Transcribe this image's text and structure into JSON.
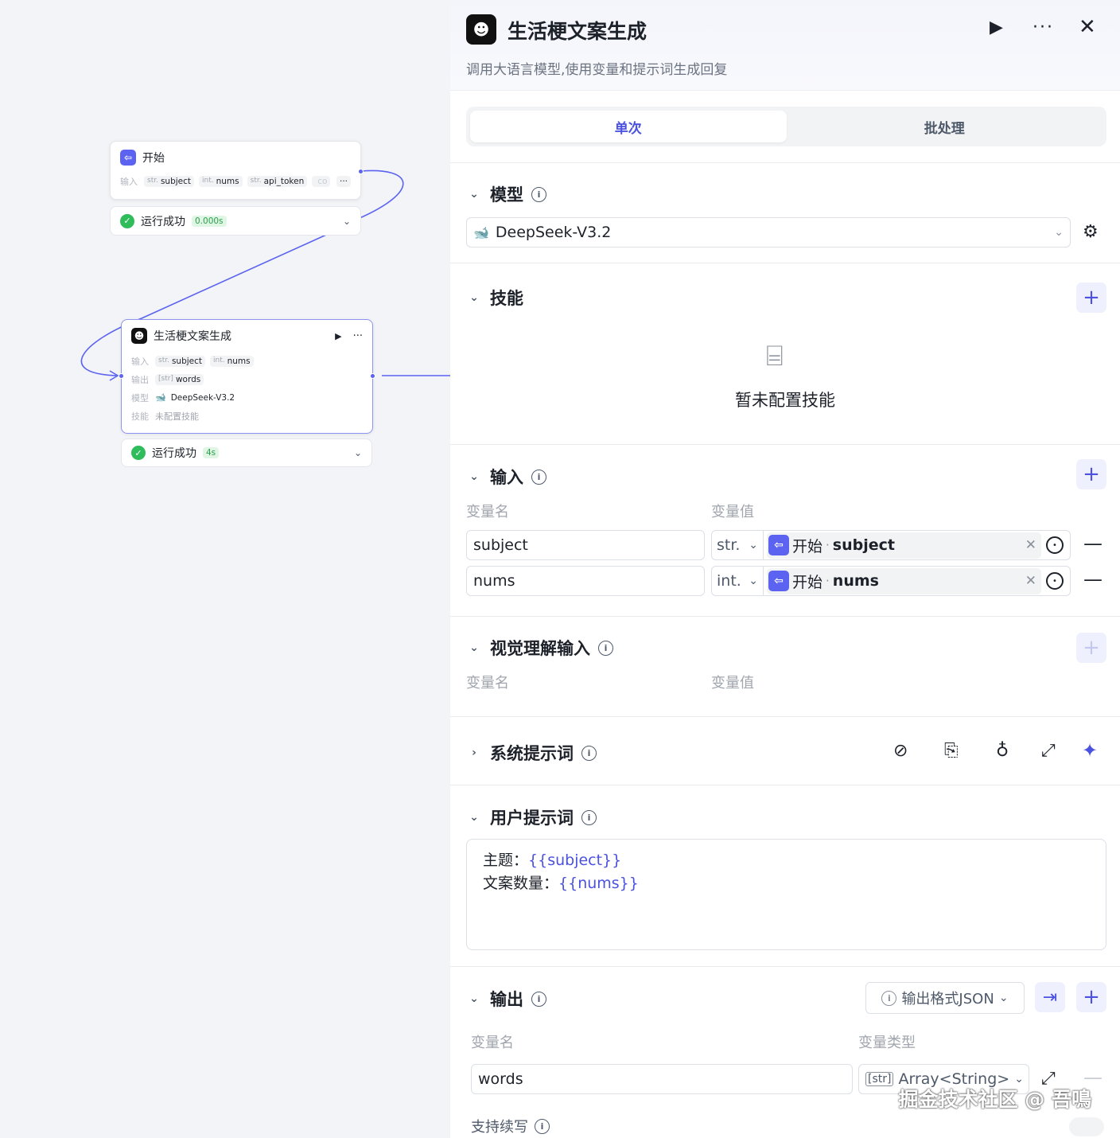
{
  "colors": {
    "accent": "#4b52e0",
    "node_blue": "#5b63f0",
    "success": "#2fbc5b",
    "edge": "#5b63f0"
  },
  "canvas": {
    "start_node": {
      "title": "开始",
      "inputs_label": "输入",
      "inputs": [
        {
          "type": "str.",
          "name": "subject"
        },
        {
          "type": "int.",
          "name": "nums"
        },
        {
          "type": "str.",
          "name": "api_token"
        },
        {
          "type": "",
          "name": "co"
        }
      ],
      "more": "···",
      "status_label": "运行成功",
      "status_time": "0.000s"
    },
    "llm_node": {
      "title": "生活梗文案生成",
      "inputs_label": "输入",
      "inputs": [
        {
          "type": "str.",
          "name": "subject"
        },
        {
          "type": "int.",
          "name": "nums"
        }
      ],
      "outputs_label": "输出",
      "outputs": [
        {
          "type": "[str]",
          "name": "words"
        }
      ],
      "model_label": "模型",
      "model_name": "DeepSeek-V3.2",
      "skill_label": "技能",
      "skill_value": "未配置技能",
      "status_label": "运行成功",
      "status_time": "4s"
    }
  },
  "panel": {
    "title": "生活梗文案生成",
    "description": "调用大语言模型,使用变量和提示词生成回复",
    "tabs": [
      {
        "label": "单次",
        "active": true
      },
      {
        "label": "批处理",
        "active": false
      }
    ],
    "model": {
      "title": "模型",
      "value": "DeepSeek-V3.2"
    },
    "skills": {
      "title": "技能",
      "empty_text": "暂未配置技能"
    },
    "input": {
      "title": "输入",
      "col_name": "变量名",
      "col_value": "变量值",
      "rows": [
        {
          "name": "subject",
          "type": "str.",
          "source_node": "开始",
          "sep": "·",
          "source_var": "subject"
        },
        {
          "name": "nums",
          "type": "int.",
          "source_node": "开始",
          "sep": "·",
          "source_var": "nums"
        }
      ]
    },
    "vision": {
      "title": "视觉理解输入",
      "col_name": "变量名",
      "col_value": "变量值"
    },
    "system_prompt": {
      "title": "系统提示词"
    },
    "user_prompt": {
      "title": "用户提示词",
      "line1_label": "主题：",
      "line1_ref": "{{subject}}",
      "line2_label": "文案数量：",
      "line2_ref": "{{nums}}"
    },
    "output": {
      "title": "输出",
      "format_label": "输出格式JSON",
      "col_name": "变量名",
      "col_type": "变量类型",
      "rows": [
        {
          "name": "words",
          "type_icon": "[str]",
          "type": "Array<String>"
        }
      ],
      "continue_label": "支持续写"
    },
    "watermark": "掘金技术社区 @ 吾鳴"
  }
}
